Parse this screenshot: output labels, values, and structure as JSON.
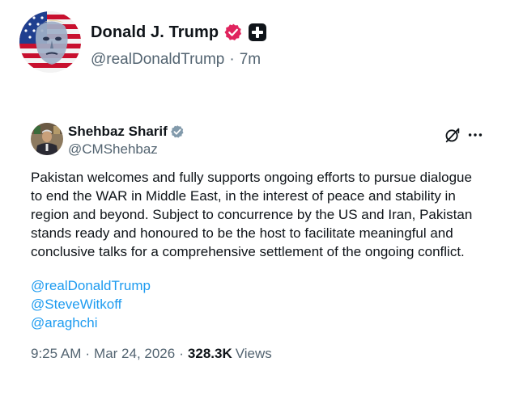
{
  "post": {
    "author": {
      "name": "Donald J. Trump",
      "handle": "@realDonaldTrump",
      "verified_color": "#e0245e",
      "badge_icon": "plus-badge-icon"
    },
    "separator": "·",
    "time": "7m"
  },
  "quoted": {
    "author": {
      "name": "Shehbaz Sharif",
      "handle": "@CMShehbaz",
      "verified_color": "#829aab"
    },
    "body": "Pakistan welcomes and fully supports ongoing efforts to pursue dialogue to end the WAR in Middle East, in the interest of peace and stability in region and beyond. Subject to concurrence by the US and Iran, Pakistan stands ready and honoured to be the host to facilitate meaningful and conclusive talks for a comprehensive settlement of the ongoing conflict.",
    "mentions": [
      "@realDonaldTrump",
      "@SteveWitkoff",
      "@araghchi"
    ],
    "footer": {
      "time": "9:25 AM",
      "separator": "·",
      "date": "Mar 24, 2026",
      "views_count": "328.3K",
      "views_label": "Views"
    },
    "icons": [
      "grok-icon",
      "more-icon"
    ]
  },
  "colors": {
    "link": "#1d9bf0",
    "secondary_text": "#536471",
    "primary_text": "#0f1419"
  }
}
